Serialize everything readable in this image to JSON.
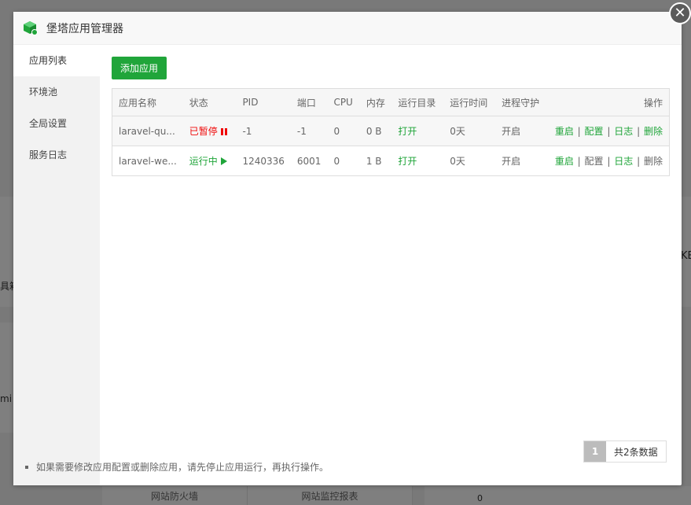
{
  "background": {
    "bottom_tabs": [
      "网站防火墙",
      "网站监控报表"
    ],
    "left_fragments": [
      "具箱",
      "mi"
    ],
    "right_fragments": [
      "KB",
      "0"
    ]
  },
  "dialog": {
    "title": "堡塔应用管理器",
    "close_symbol": "✕",
    "sidebar": [
      {
        "label": "应用列表",
        "active": true
      },
      {
        "label": "环境池",
        "active": false
      },
      {
        "label": "全局设置",
        "active": false
      },
      {
        "label": "服务日志",
        "active": false
      }
    ],
    "add_button": "添加应用",
    "table": {
      "headers": [
        "应用名称",
        "状态",
        "PID",
        "端口",
        "CPU",
        "内存",
        "运行目录",
        "运行时间",
        "进程守护",
        "操作"
      ],
      "rows": [
        {
          "name": "laravel-qu...",
          "status": "已暂停",
          "status_kind": "paused",
          "pid": "-1",
          "port": "-1",
          "cpu": "0",
          "mem": "0 B",
          "dir": "打开",
          "uptime": "0天",
          "guard": "开启",
          "ops": [
            "重启",
            "配置",
            "日志",
            "删除"
          ]
        },
        {
          "name": "laravel-we...",
          "status": "运行中",
          "status_kind": "running",
          "pid": "1240336",
          "port": "6001",
          "cpu": "0",
          "mem": "1 B",
          "dir": "打开",
          "uptime": "0天",
          "guard": "开启",
          "ops": [
            "重启",
            "配置",
            "日志",
            "删除"
          ]
        }
      ],
      "separator": "|"
    },
    "pager": {
      "current": "1",
      "total_text": "共2条数据"
    },
    "tip": "如果需要修改应用配置或删除应用，请先停止应用运行，再执行操作。"
  },
  "colors": {
    "accent": "#20a53a",
    "danger": "#ef0808"
  }
}
